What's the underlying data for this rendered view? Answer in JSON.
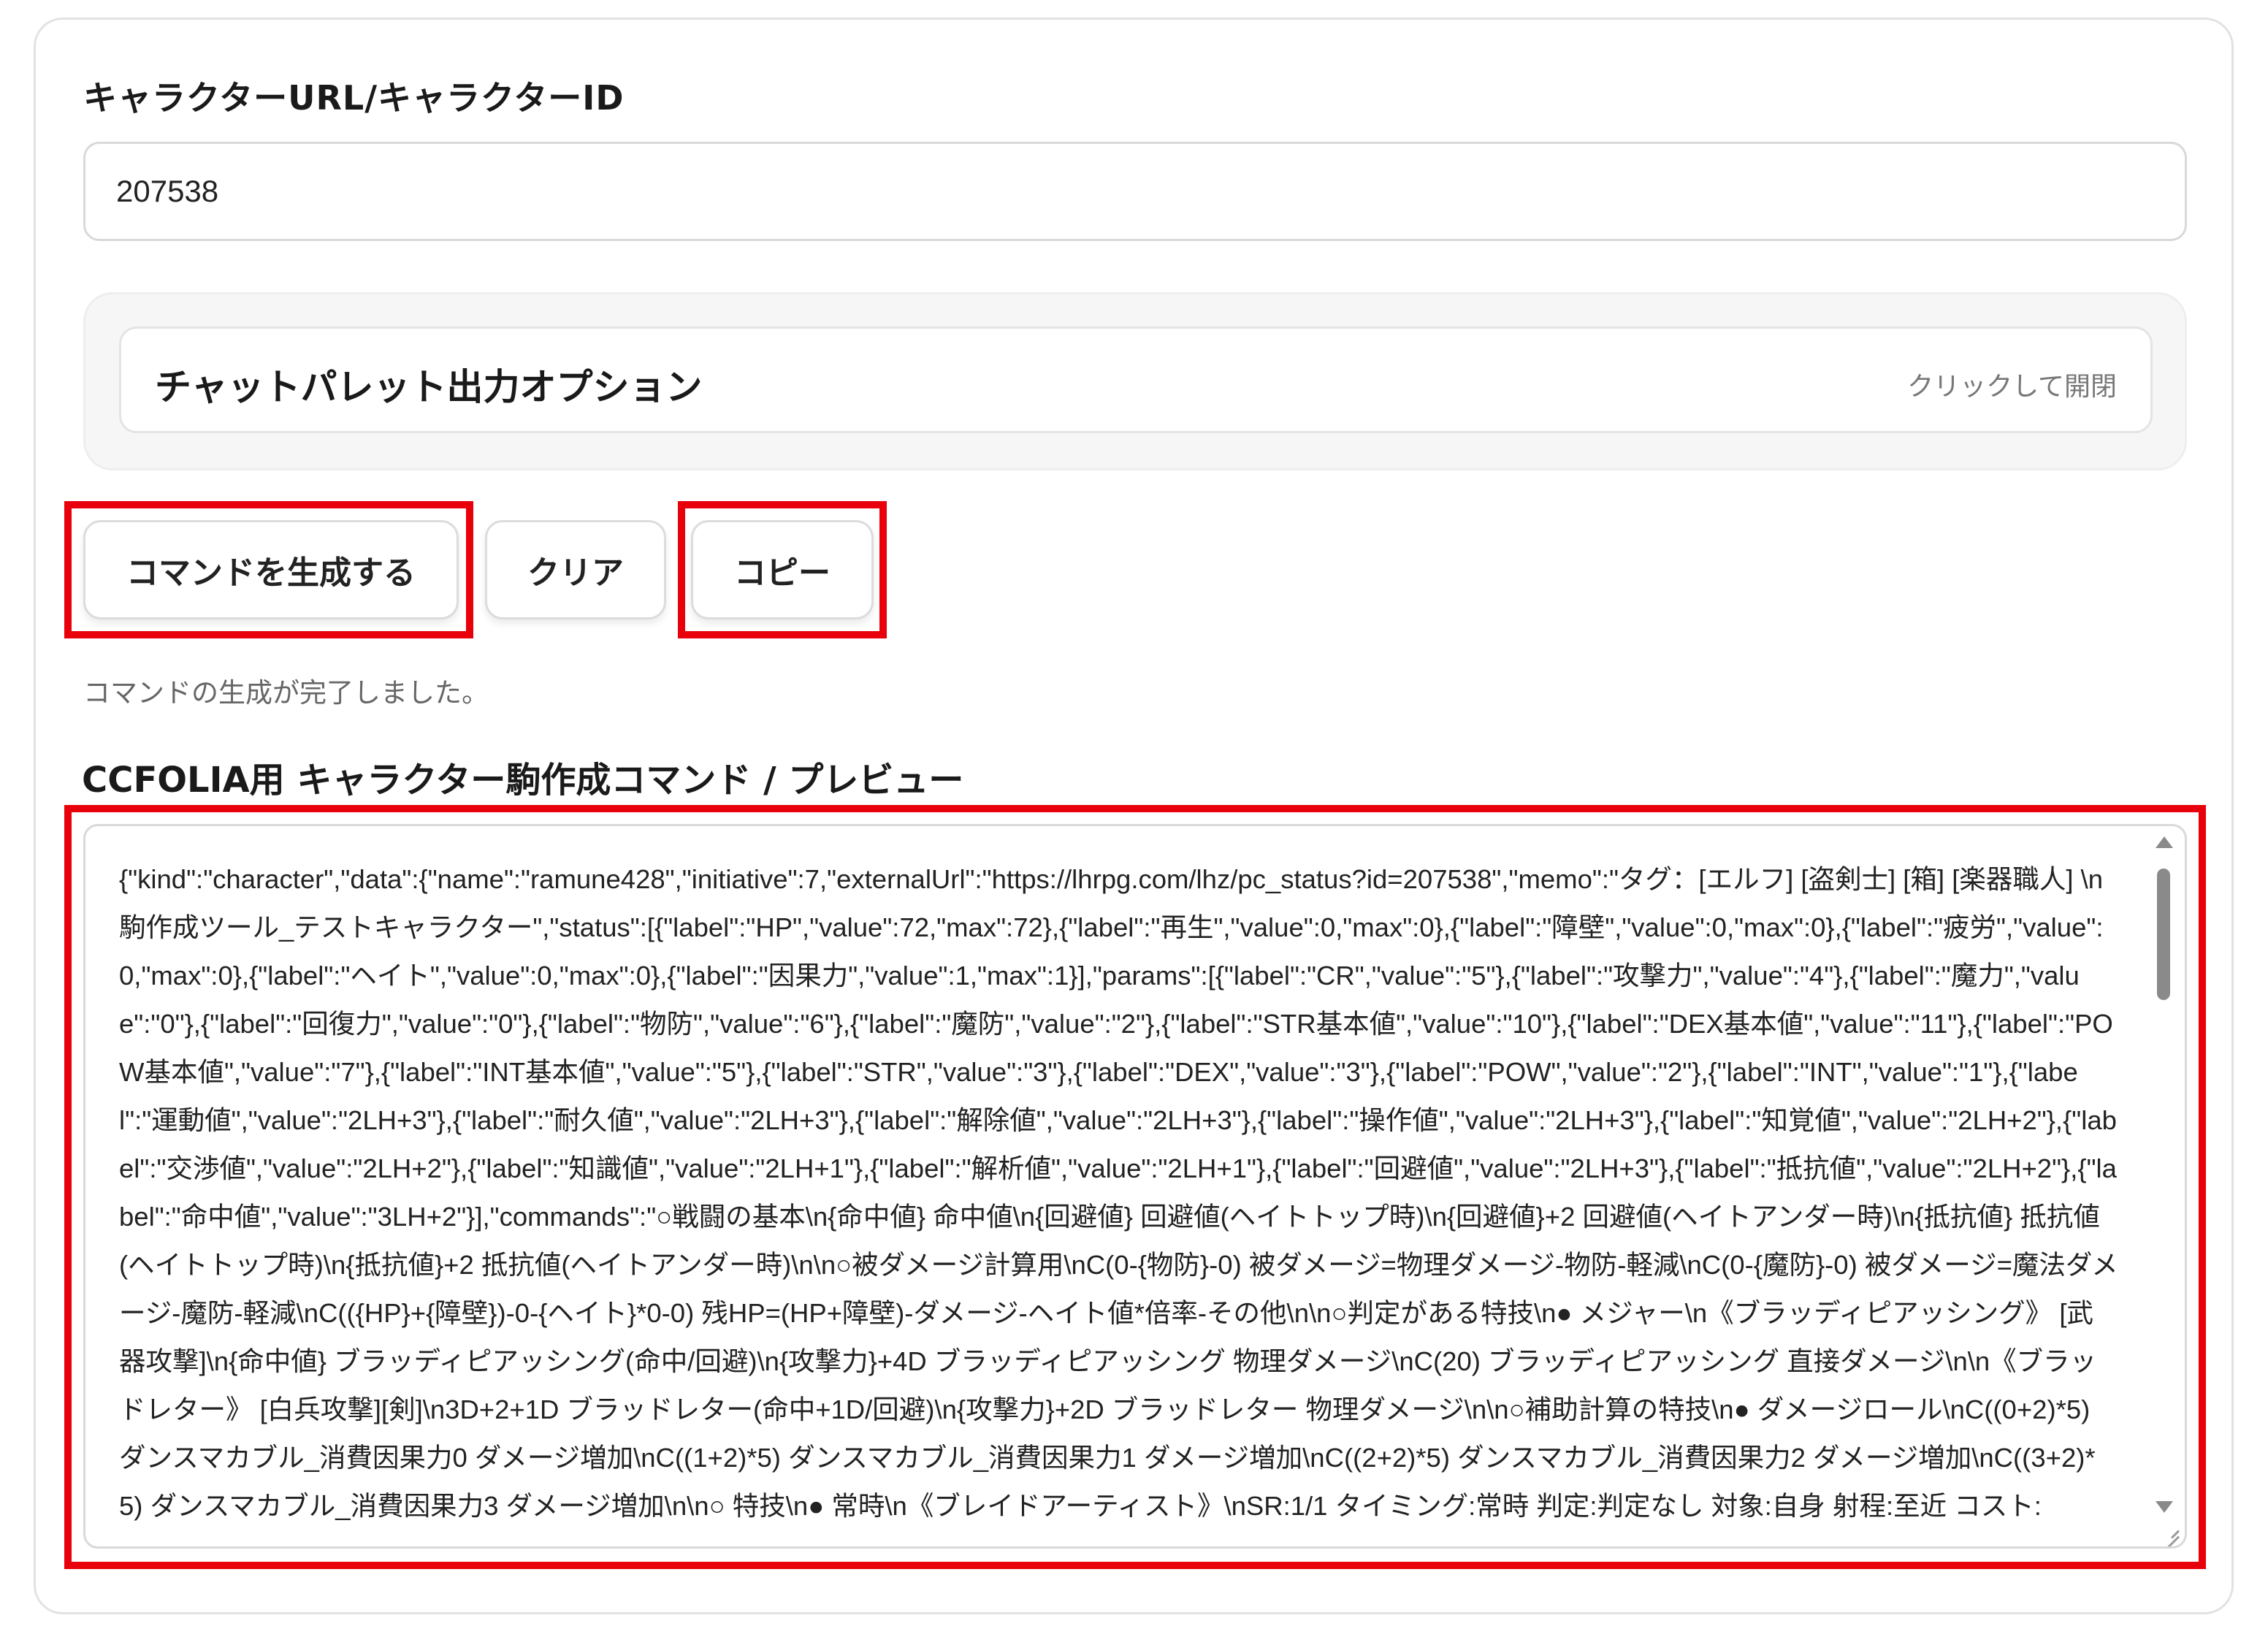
{
  "form": {
    "url_label": "キャラクターURL/キャラクターID",
    "id_value": "207538"
  },
  "options": {
    "title": "チャットパレット出力オプション",
    "hint": "クリックして開閉"
  },
  "buttons": {
    "generate": "コマンドを生成する",
    "clear": "クリア",
    "copy": "コピー"
  },
  "status": "コマンドの生成が完了しました。",
  "preview": {
    "label": "CCFOLIA用 キャラクター駒作成コマンド / プレビュー",
    "text": "{\"kind\":\"character\",\"data\":{\"name\":\"ramune428\",\"initiative\":7,\"externalUrl\":\"https://lhrpg.com/lhz/pc_status?id=207538\",\"memo\":\"タグ：[エルフ] [盗剣士] [箱] [楽器職人] \\n 駒作成ツール_テストキャラクター\",\"status\":[{\"label\":\"HP\",\"value\":72,\"max\":72},{\"label\":\"再生\",\"value\":0,\"max\":0},{\"label\":\"障壁\",\"value\":0,\"max\":0},{\"label\":\"疲労\",\"value\":0,\"max\":0},{\"label\":\"ヘイト\",\"value\":0,\"max\":0},{\"label\":\"因果力\",\"value\":1,\"max\":1}],\"params\":[{\"label\":\"CR\",\"value\":\"5\"},{\"label\":\"攻撃力\",\"value\":\"4\"},{\"label\":\"魔力\",\"value\":\"0\"},{\"label\":\"回復力\",\"value\":\"0\"},{\"label\":\"物防\",\"value\":\"6\"},{\"label\":\"魔防\",\"value\":\"2\"},{\"label\":\"STR基本値\",\"value\":\"10\"},{\"label\":\"DEX基本値\",\"value\":\"11\"},{\"label\":\"POW基本値\",\"value\":\"7\"},{\"label\":\"INT基本値\",\"value\":\"5\"},{\"label\":\"STR\",\"value\":\"3\"},{\"label\":\"DEX\",\"value\":\"3\"},{\"label\":\"POW\",\"value\":\"2\"},{\"label\":\"INT\",\"value\":\"1\"},{\"label\":\"運動値\",\"value\":\"2LH+3\"},{\"label\":\"耐久値\",\"value\":\"2LH+3\"},{\"label\":\"解除値\",\"value\":\"2LH+3\"},{\"label\":\"操作値\",\"value\":\"2LH+3\"},{\"label\":\"知覚値\",\"value\":\"2LH+2\"},{\"label\":\"交渉値\",\"value\":\"2LH+2\"},{\"label\":\"知識値\",\"value\":\"2LH+1\"},{\"label\":\"解析値\",\"value\":\"2LH+1\"},{\"label\":\"回避値\",\"value\":\"2LH+3\"},{\"label\":\"抵抗値\",\"value\":\"2LH+2\"},{\"label\":\"命中値\",\"value\":\"3LH+2\"}],\"commands\":\"○戦闘の基本\\n{命中値} 命中値\\n{回避値} 回避値(ヘイトトップ時)\\n{回避値}+2 回避値(ヘイトアンダー時)\\n{抵抗値} 抵抗値(ヘイトトップ時)\\n{抵抗値}+2 抵抗値(ヘイトアンダー時)\\n\\n○被ダメージ計算用\\nC(0-{物防}-0) 被ダメージ=物理ダメージ-物防-軽減\\nC(0-{魔防}-0) 被ダメージ=魔法ダメージ-魔防-軽減\\nC(({HP}+{障壁})-0-{ヘイト}*0-0) 残HP=(HP+障壁)-ダメージ-ヘイト値*倍率-その他\\n\\n○判定がある特技\\n● メジャー\\n《ブラッディピアッシング》 [武器攻撃]\\n{命中値} ブラッディピアッシング(命中/回避)\\n{攻撃力}+4D ブラッディピアッシング 物理ダメージ\\nC(20) ブラッディピアッシング 直接ダメージ\\n\\n《ブラッドレター》 [白兵攻撃][剣]\\n3D+2+1D ブラッドレター(命中+1D/回避)\\n{攻撃力}+2D ブラッドレター 物理ダメージ\\n\\n○補助計算の特技\\n● ダメージロール\\nC((0+2)*5) ダンスマカブル_消費因果力0 ダメージ増加\\nC((1+2)*5) ダンスマカブル_消費因果力1 ダメージ増加\\nC((2+2)*5) ダンスマカブル_消費因果力2 ダメージ増加\\nC((3+2)*5) ダンスマカブル_消費因果力3 ダメージ増加\\n\\n○ 特技\\n● 常時\\n《ブレイドアーティスト》\\nSR:1/1 タイミング:常時 判定:判定なし 対象:自身 射程:至近 コスト:"
  }
}
